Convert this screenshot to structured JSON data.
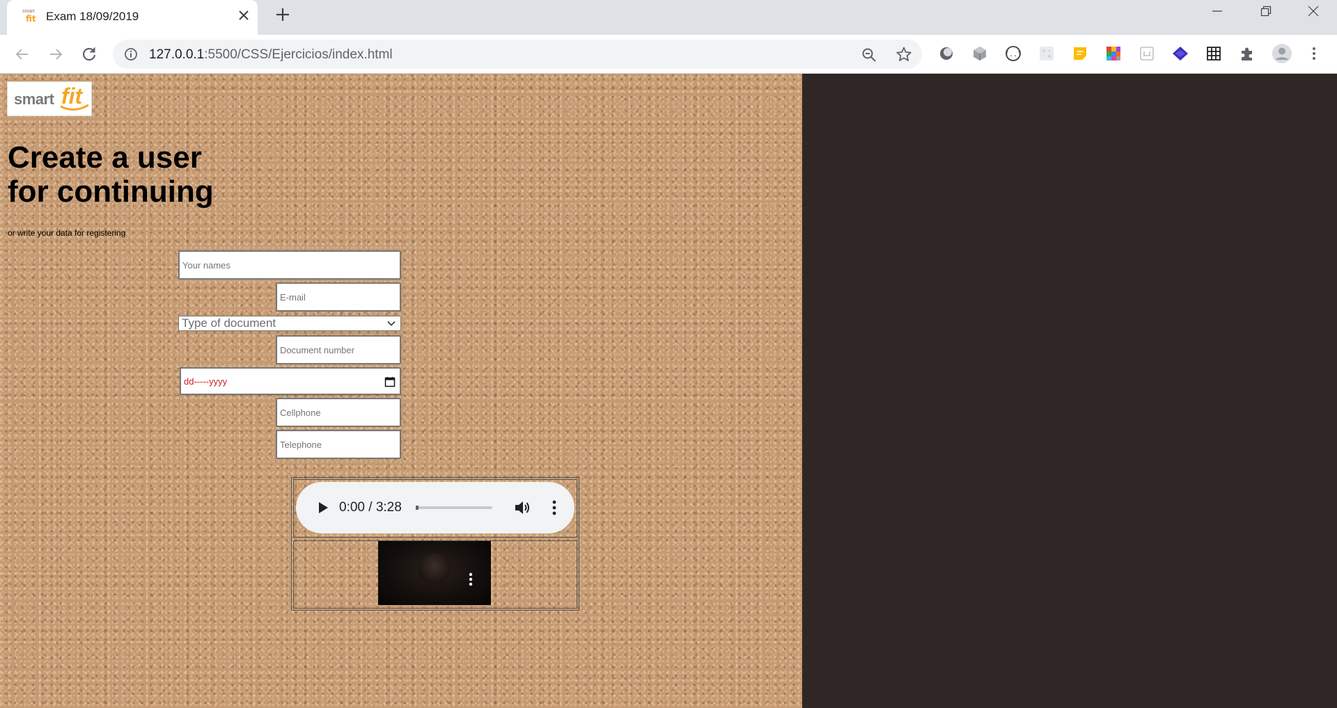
{
  "browser": {
    "tab_title": "Exam 18/09/2019",
    "favicon_text_top": "smart",
    "favicon_text_bottom": "fit",
    "url_host": "127.0.0.1",
    "url_path": ":5500/CSS/Ejercicios/index.html",
    "icons": [
      "info-icon",
      "zoom-out-icon",
      "star-icon",
      "extension-icon",
      "puzzle-icon",
      "profile-icon",
      "menu-icon"
    ]
  },
  "page": {
    "logo": {
      "smart": "smart",
      "fit": "fit"
    },
    "heading_line1": "Create a user",
    "heading_line2": "for continuing",
    "subtitle": "or write your data for registering",
    "form": {
      "names_placeholder": "Your names",
      "email_placeholder": "E-mail",
      "doctype_selected": "Type of document",
      "docnum_placeholder": "Document number",
      "date_placeholder": "dd-----yyyy",
      "cellphone_placeholder": "Cellphone",
      "telephone_placeholder": "Telephone"
    },
    "audio": {
      "time": "0:00 / 3:28",
      "progress": 0
    },
    "colors": {
      "background_right": "#2f2725",
      "date_text": "#d32020",
      "logo_orange": "#f6a623"
    }
  }
}
